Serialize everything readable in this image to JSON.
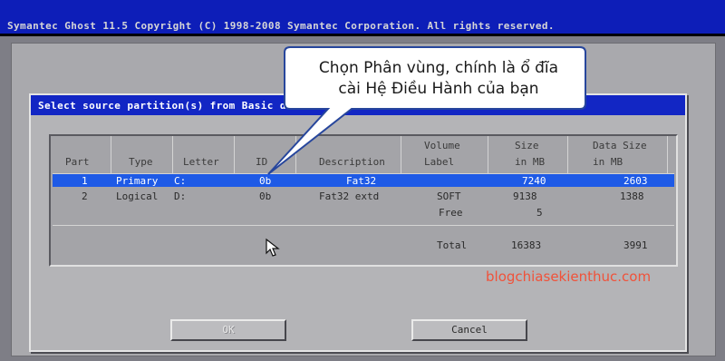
{
  "app": {
    "title": "Symantec Ghost 11.5   Copyright (C) 1998-2008 Symantec Corporation. All rights reserved."
  },
  "dialog": {
    "title": "Select source partition(s) from Basic d",
    "table": {
      "headers": {
        "part": "Part",
        "type": "Type",
        "letter": "Letter",
        "id": "ID",
        "description": "Description",
        "volume_label_1": "Volume",
        "volume_label_2": "Label",
        "size_1": "Size",
        "size_2": "in MB",
        "data_size_1": "Data Size",
        "data_size_2": "in MB"
      },
      "rows": [
        {
          "part": "1",
          "type": "Primary",
          "letter": "C:",
          "id": "0b",
          "description": "Fat32",
          "volume_label": "",
          "size": "7240",
          "data_size": "2603"
        },
        {
          "part": "2",
          "type": "Logical",
          "letter": "D:",
          "id": "0b",
          "description": "Fat32 extd",
          "volume_label": "SOFT",
          "size": "9138",
          "data_size": "1388"
        }
      ],
      "free": {
        "label": "Free",
        "size": "5"
      },
      "total": {
        "label": "Total",
        "size": "16383",
        "data_size": "3991"
      }
    },
    "buttons": {
      "ok": "OK",
      "cancel": "Cancel"
    }
  },
  "callout": {
    "line1": "Chọn Phân vùng, chính là ổ đĩa",
    "line2": "cài Hệ Điều Hành của bạn"
  },
  "watermark": "blogchiasekienthuc.com",
  "colors": {
    "titlebar": "#1226c4",
    "selection": "#1e5ae6",
    "watermark": "#f0523a"
  }
}
